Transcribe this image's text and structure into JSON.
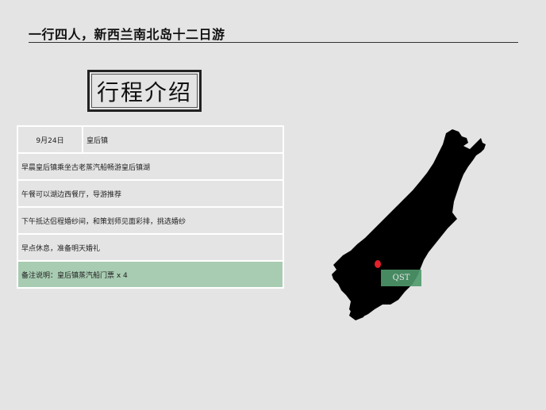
{
  "header": {
    "title": "一行四人，新西兰南北岛十二日游"
  },
  "section": {
    "stamp_title": "行程介绍"
  },
  "itinerary": {
    "date": "9月24日",
    "location": "皇后镇",
    "rows": [
      "早晨皇后镇乘坐古老蒸汽船畅游皇后镇湖",
      "午餐可以湖边西餐厅，导游推荐",
      "下午抵达侣程婚纱间，和策划师见面彩排，挑选婚纱",
      "早点休息，准备明天婚礼"
    ],
    "note": "备注说明：皇后镇蒸汽船门票 x 4"
  },
  "map": {
    "marker_label": "QST",
    "marker_color": "#e4202a",
    "label_bg": "#4f9a6c",
    "land_color": "#000000"
  }
}
